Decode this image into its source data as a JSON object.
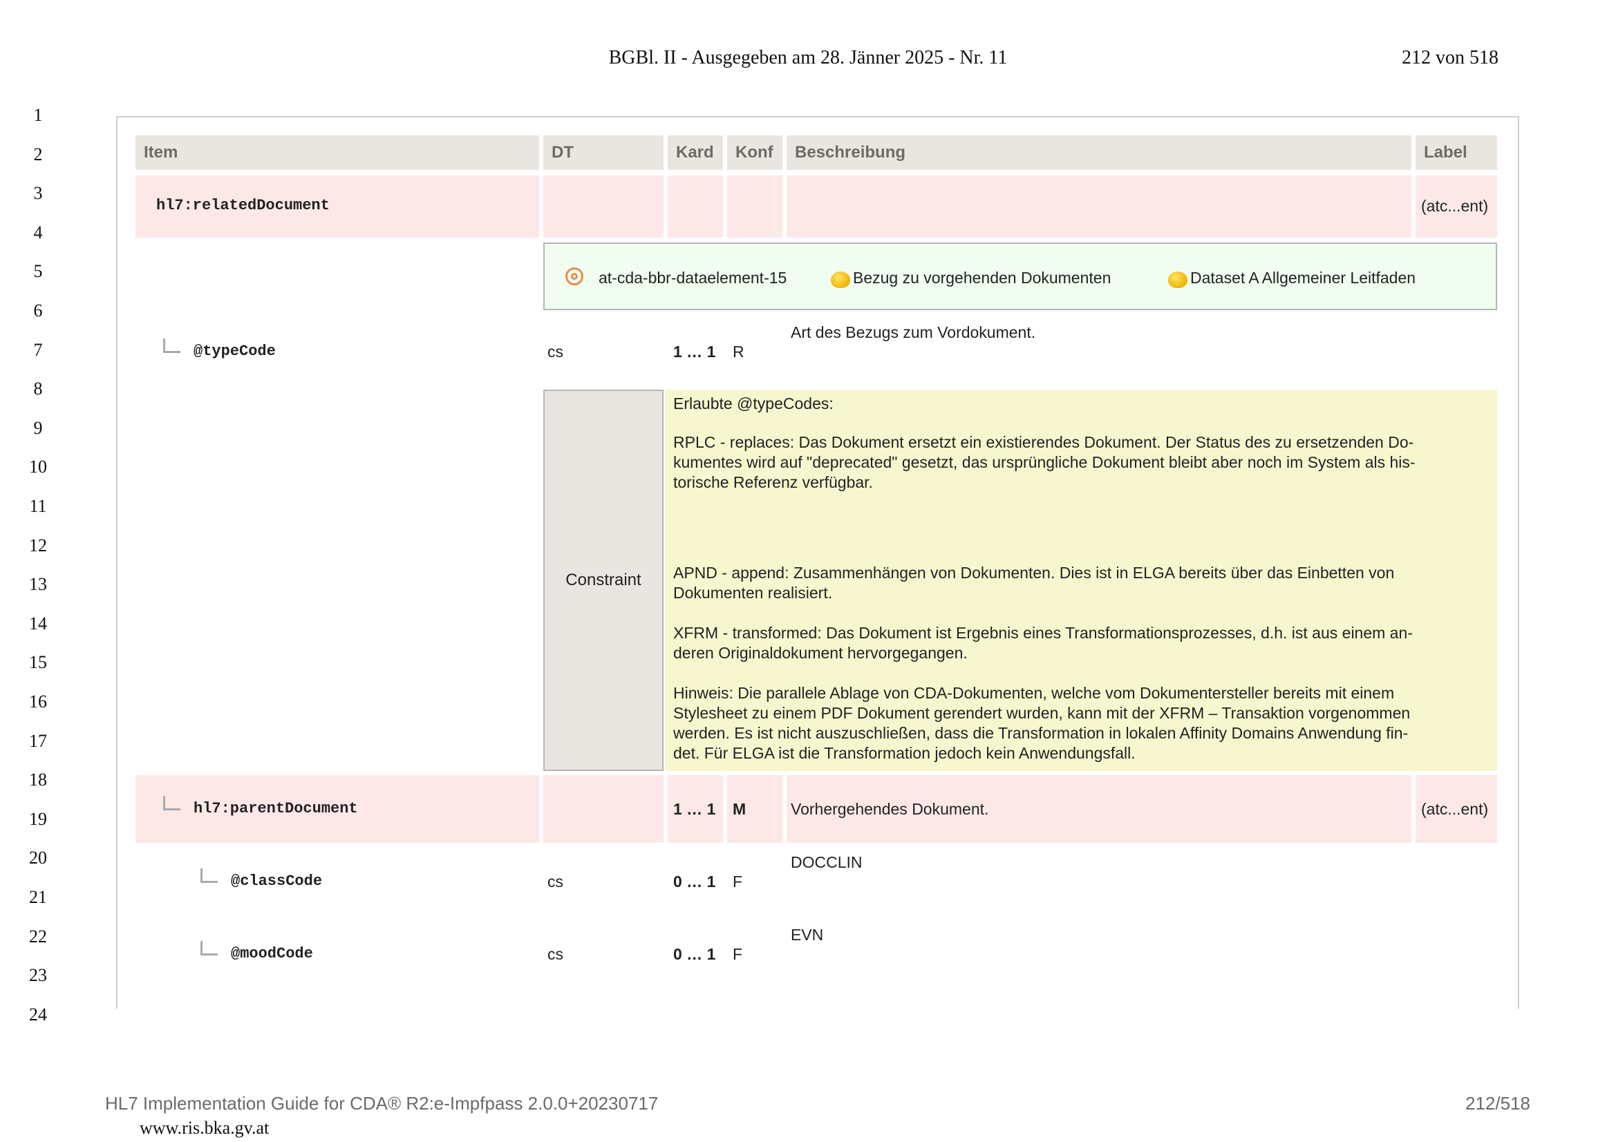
{
  "header": {
    "title": "BGBl. II - Ausgegeben am 28. Jänner 2025 - Nr. 11",
    "page": "212 von 518"
  },
  "line_numbers": [
    "1",
    "2",
    "3",
    "4",
    "5",
    "6",
    "7",
    "8",
    "9",
    "10",
    "11",
    "12",
    "13",
    "14",
    "15",
    "16",
    "17",
    "18",
    "19",
    "20",
    "21",
    "22",
    "23",
    "24"
  ],
  "table": {
    "columns": {
      "item": "Item",
      "dt": "DT",
      "kard": "Kard",
      "konf": "Konf",
      "beschreibung": "Beschreibung",
      "label": "Label"
    },
    "related_document": {
      "item": "hl7:relatedDocument",
      "label": "(atc...ent)"
    },
    "references": {
      "dataelement": "at-cda-bbr-dataelement-15",
      "concept": "Bezug zu vorgehenden Dokumenten",
      "dataset": "Dataset A Allgemeiner Leitfaden"
    },
    "type_code": {
      "item": "@typeCode",
      "dt": "cs",
      "kard": "1 … 1",
      "konf": "R",
      "beschreibung": "Art des Bezugs zum Vordokument."
    },
    "constraint": {
      "label": "Constraint",
      "intro": "Erlaubte @typeCodes:",
      "rplc": "RPLC - replaces: Das Dokument ersetzt ein existierendes Dokument. Der Status des zu ersetzenden Do-\nkumentes wird auf \"deprecated\" gesetzt, das ursprüngliche Dokument bleibt aber noch im System als his-\ntorische Referenz verfügbar.",
      "apnd": "APND - append: Zusammenhängen von Dokumenten. Dies ist in ELGA bereits über das Einbetten von\nDokumenten realisiert.",
      "xfrm": "XFRM - transformed: Das Dokument ist Ergebnis eines Transformationsprozesses, d.h. ist aus einem an-\nderen Originaldokument hervorgegangen.",
      "hinweis": "Hinweis: Die parallele Ablage von CDA-Dokumenten, welche vom Dokumentersteller bereits mit einem\nStylesheet zu einem PDF Dokument gerendert wurden, kann mit der XFRM – Transaktion vorgenommen\nwerden. Es ist nicht auszuschließen, dass die Transformation in lokalen Affinity Domains Anwendung fin-\ndet. Für ELGA ist die Transformation jedoch kein Anwendungsfall."
    },
    "parent_document": {
      "item": "hl7:parentDocument",
      "kard": "1 … 1",
      "konf": "M",
      "beschreibung": "Vorhergehendes Dokument.",
      "label": "(atc...ent)"
    },
    "class_code": {
      "item": "@classCode",
      "dt": "cs",
      "kard": "0 … 1",
      "konf": "F",
      "beschreibung": "DOCCLIN"
    },
    "mood_code": {
      "item": "@moodCode",
      "dt": "cs",
      "kard": "0 … 1",
      "konf": "F",
      "beschreibung": "EVN"
    }
  },
  "footer": {
    "guide": "HL7 Implementation Guide for CDA® R2:e-Impfpass 2.0.0+20230717",
    "page": "212/518",
    "url": "www.ris.bka.gv.at"
  }
}
